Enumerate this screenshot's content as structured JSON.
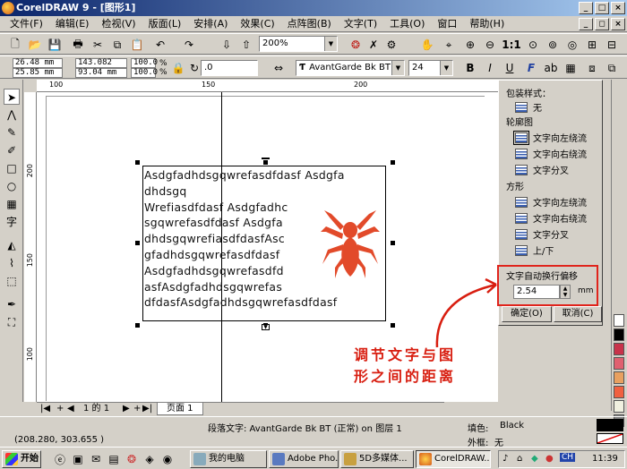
{
  "title": "CorelDRAW 9 - [图形1]",
  "menus": [
    "文件(F)",
    "编辑(E)",
    "检视(V)",
    "版面(L)",
    "安排(A)",
    "效果(C)",
    "点阵图(B)",
    "文字(T)",
    "工具(O)",
    "窗口",
    "帮助(H)"
  ],
  "zoom": "200%",
  "pos_x": "26.48 mm",
  "pos_y": "25.85 mm",
  "size_w": "143.082 mm",
  "size_h": "93.04 mm",
  "scale_x": "100.0",
  "scale_y": "100.0",
  "pct": "%",
  "angle": ".0",
  "font_name": "AvantGarde Bk BT",
  "font_size": "24",
  "fmt": [
    "B",
    "I",
    "U"
  ],
  "ruler_h": [
    "100",
    "150",
    "200"
  ],
  "ruler_v": [
    "200",
    "150",
    "100"
  ],
  "para_text": [
    "Asdgfadhdsgqwrefasdfdasf Asdgfa",
    "dhdsgq",
    "Wrefiasdfdasf Asdgfadhc",
    "sgqwrefasdfdasf Asdgfa",
    "dhdsgqwrefiasdfdasfAsc",
    "gfadhdsgqwrefasdfdasf",
    "Asdgfadhdsgqwrefasdfd",
    "asfAsdgfadhdsgqwrefas",
    "dfdasfAsdgfadhdsgqwrefasdfdasf"
  ],
  "panel": {
    "sec1": "包装样式：",
    "none": "无",
    "sec2": "轮廓图",
    "c1": "文字向左绕流",
    "c2": "文字向右绕流",
    "c3": "文字分叉",
    "sec3": "方形",
    "s1": "文字向左绕流",
    "s2": "文字向右绕流",
    "s3": "文字分叉",
    "s4": "上/下",
    "offset_label": "文字自动换行偏移",
    "offset_val": "2.54",
    "offset_unit": "mm",
    "ok": "确定(O)",
    "cancel": "取消(C)"
  },
  "page_nav": "1 的 1",
  "page_tab": "页面 1",
  "status": {
    "text": "段落文字: AvantGarde Bk BT (正常) on 图层 1",
    "coords": "(208.280, 303.655 )",
    "fill_label": "填色:",
    "fill_val": "Black",
    "outline_label": "外框:",
    "outline_val": "无"
  },
  "annotation": [
    "调节文字与图",
    "形之间的距离"
  ],
  "taskbar": {
    "start": "开始",
    "tasks": [
      "我的电脑",
      "Adobe Pho...",
      "5D多媒体...",
      "CorelDRAW..."
    ],
    "clock": "11:39",
    "ime": "CH"
  },
  "colors": {
    "accent": "#e0241c",
    "spider": "#e24a2a",
    "title": "#0a246a"
  },
  "palette": [
    "#ffffff",
    "#000000",
    "#c8324a",
    "#e06070",
    "#e8a060",
    "#f06040",
    "#f0f0e0",
    "#808080"
  ]
}
